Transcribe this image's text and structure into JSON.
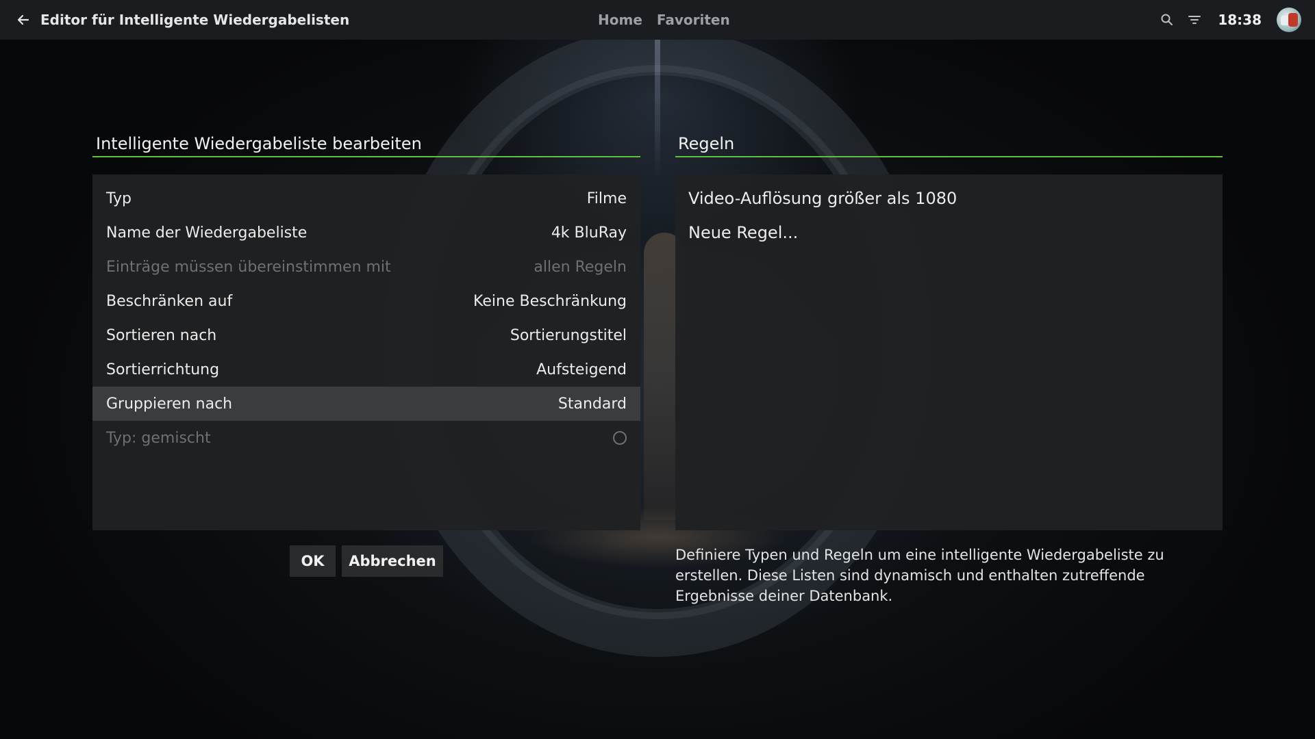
{
  "header": {
    "title": "Editor für Intelligente Wiedergabelisten",
    "nav": [
      "Home",
      "Favoriten"
    ],
    "clock": "18:38",
    "icons": {
      "back": "arrow-left-icon",
      "search": "search-icon",
      "filter": "filter-icon",
      "avatar": "profile-avatar"
    }
  },
  "left_panel": {
    "title": "Intelligente Wiedergabeliste bearbeiten",
    "rows": [
      {
        "label": "Typ",
        "value": "Filme",
        "enabled": true
      },
      {
        "label": "Name der Wiedergabeliste",
        "value": "4k BluRay",
        "enabled": true
      },
      {
        "label": "Einträge müssen übereinstimmen mit",
        "value": "allen Regeln",
        "enabled": false
      },
      {
        "label": "Beschränken auf",
        "value": "Keine Beschränkung",
        "enabled": true
      },
      {
        "label": "Sortieren nach",
        "value": "Sortierungstitel",
        "enabled": true
      },
      {
        "label": "Sortierrichtung",
        "value": "Aufsteigend",
        "enabled": true
      },
      {
        "label": "Gruppieren nach",
        "value": "Standard",
        "enabled": true,
        "focused": true
      },
      {
        "label": "Typ: gemischt",
        "value": "",
        "enabled": false,
        "toggle": "off"
      }
    ]
  },
  "right_panel": {
    "title": "Regeln",
    "rules": [
      "Video-Auflösung größer als 1080",
      "Neue Regel..."
    ]
  },
  "buttons": {
    "ok": "OK",
    "cancel": "Abbrechen"
  },
  "help_text": "Definiere Typen und Regeln um eine intelligente Wiedergabeliste zu erstellen. Diese Listen sind dynamisch und enthalten zutreffende Ergebnisse deiner Datenbank.",
  "colors": {
    "accent": "#5fbf3f",
    "topbar": "#1a1c1f",
    "panel": "#202123",
    "focus": "#3b3c3e",
    "disabled_text": "#6e7073"
  }
}
